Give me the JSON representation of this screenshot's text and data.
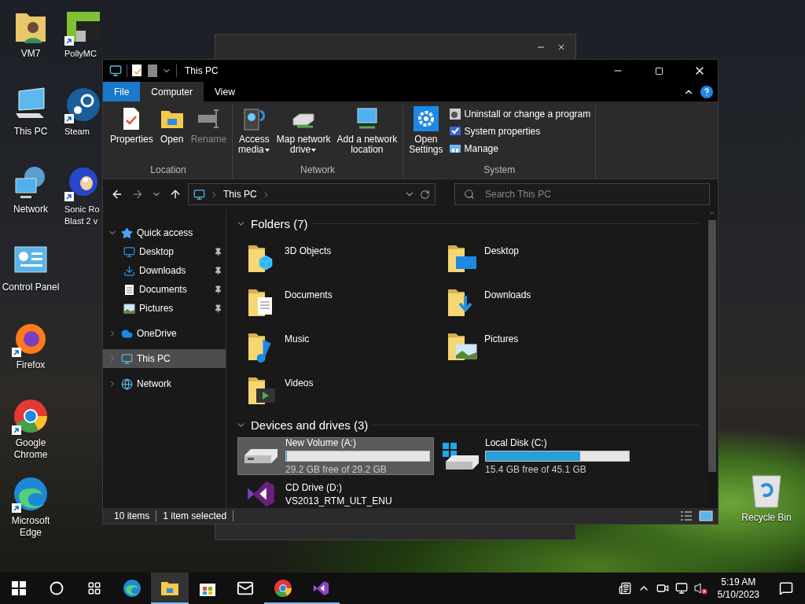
{
  "desktop": {
    "left_column": [
      {
        "label": "VM7",
        "kind": "user-folder",
        "shortcut": false
      },
      {
        "label": "This PC",
        "kind": "pc",
        "shortcut": false
      },
      {
        "label": "Network",
        "kind": "network",
        "shortcut": false
      },
      {
        "label": "Control Panel",
        "kind": "control-panel",
        "shortcut": false
      },
      {
        "label": "Firefox",
        "kind": "firefox",
        "shortcut": true
      },
      {
        "label": "Google Chrome",
        "kind": "chrome",
        "shortcut": true
      },
      {
        "label": "Microsoft Edge",
        "kind": "edge",
        "shortcut": true
      }
    ],
    "right_column": [
      {
        "label": "PollyMC",
        "kind": "pollymc",
        "shortcut": true
      },
      {
        "label": "Steam",
        "kind": "steam",
        "shortcut": true
      },
      {
        "label": "Sonic Ro Blast 2 v",
        "kind": "sonic",
        "shortcut": true
      }
    ],
    "recycle_bin": {
      "label": "Recycle Bin"
    }
  },
  "window": {
    "title": "This PC",
    "ribbon": {
      "tabs": [
        {
          "label": "File",
          "kind": "file",
          "selected": false
        },
        {
          "label": "Computer",
          "kind": "tab",
          "selected": true
        },
        {
          "label": "View",
          "kind": "tab",
          "selected": false
        }
      ],
      "groups": [
        {
          "label": "Location",
          "buttons": [
            {
              "lines": [
                "Properties"
              ],
              "kind": "properties",
              "disabled": false,
              "dropdown": false
            },
            {
              "lines": [
                "Open"
              ],
              "kind": "open",
              "disabled": false,
              "dropdown": false
            },
            {
              "lines": [
                "Rename"
              ],
              "kind": "rename",
              "disabled": true,
              "dropdown": false
            }
          ]
        },
        {
          "label": "Network",
          "buttons": [
            {
              "lines": [
                "Access",
                "media"
              ],
              "kind": "media",
              "disabled": false,
              "dropdown": true
            },
            {
              "lines": [
                "Map network",
                "drive"
              ],
              "kind": "map-drive",
              "disabled": false,
              "dropdown": true
            },
            {
              "lines": [
                "Add a network",
                "location"
              ],
              "kind": "network-location",
              "disabled": false,
              "dropdown": false
            }
          ]
        },
        {
          "label": "System",
          "buttons": [
            {
              "lines": [
                "Open",
                "Settings"
              ],
              "kind": "settings",
              "disabled": false,
              "dropdown": false
            }
          ],
          "small_buttons": [
            {
              "label": "Uninstall or change a program",
              "kind": "uninstall"
            },
            {
              "label": "System properties",
              "kind": "system"
            },
            {
              "label": "Manage",
              "kind": "manage"
            }
          ]
        }
      ]
    },
    "navigation": {
      "forward_disabled": true,
      "address": "This PC",
      "search_placeholder": "Search This PC"
    },
    "sidebar": {
      "items": [
        {
          "label": "Quick access",
          "kind": "star",
          "expanded": true,
          "selected": false,
          "children": [
            {
              "label": "Desktop",
              "kind": "desktop",
              "pinned": true,
              "selected": false
            },
            {
              "label": "Downloads",
              "kind": "download",
              "pinned": true,
              "selected": false
            },
            {
              "label": "Documents",
              "kind": "documents",
              "pinned": true,
              "selected": false
            },
            {
              "label": "Pictures",
              "kind": "pictures",
              "pinned": true,
              "selected": false
            }
          ]
        },
        {
          "label": "OneDrive",
          "kind": "cloud",
          "expanded": false,
          "selected": false
        },
        {
          "label": "This PC",
          "kind": "pc",
          "expanded": false,
          "selected": true
        },
        {
          "label": "Network",
          "kind": "network",
          "expanded": false,
          "selected": false
        }
      ]
    },
    "folders": {
      "heading": "Folders (7)",
      "items": [
        {
          "label": "3D Objects",
          "kind": "objects3d"
        },
        {
          "label": "Desktop",
          "kind": "desktop"
        },
        {
          "label": "Documents",
          "kind": "documents"
        },
        {
          "label": "Downloads",
          "kind": "downloads"
        },
        {
          "label": "Music",
          "kind": "music"
        },
        {
          "label": "Pictures",
          "kind": "pictures"
        },
        {
          "label": "Videos",
          "kind": "videos"
        }
      ]
    },
    "drives": {
      "heading": "Devices and drives (3)",
      "items": [
        {
          "label": "New Volume (A:)",
          "kind": "hdd",
          "selected": true,
          "level": 0.0,
          "reading": "29.2 GB free of 29.2 GB"
        },
        {
          "label": "Local Disk (C:)",
          "kind": "windows-hdd",
          "selected": false,
          "level": 0.66,
          "reading": "15.4 GB free of 45.1 GB"
        },
        {
          "label": "CD Drive (D:)",
          "kind": "disc-app",
          "selected": false,
          "subtitle": "VS2013_RTM_ULT_ENU"
        }
      ]
    },
    "status_bar": {
      "count": "10 items",
      "selection": "1 item selected"
    }
  },
  "taskbar": {
    "buttons": [
      {
        "kind": "start",
        "running": false,
        "selected": false
      },
      {
        "kind": "search",
        "running": false,
        "selected": false
      },
      {
        "kind": "task-view",
        "running": false,
        "selected": false
      },
      {
        "kind": "edge",
        "running": false,
        "selected": false
      },
      {
        "kind": "explorer",
        "running": true,
        "selected": true
      },
      {
        "kind": "store",
        "running": false,
        "selected": false
      },
      {
        "kind": "mail",
        "running": false,
        "selected": false
      },
      {
        "kind": "chrome",
        "running": true,
        "selected": false
      },
      {
        "kind": "visual-studio",
        "running": true,
        "selected": false
      }
    ],
    "tray": [
      {
        "kind": "news"
      },
      {
        "kind": "chevron"
      },
      {
        "kind": "meet"
      },
      {
        "kind": "network"
      },
      {
        "kind": "volume-muted"
      }
    ],
    "time": "5:19 AM",
    "date": "5/10/2023"
  }
}
